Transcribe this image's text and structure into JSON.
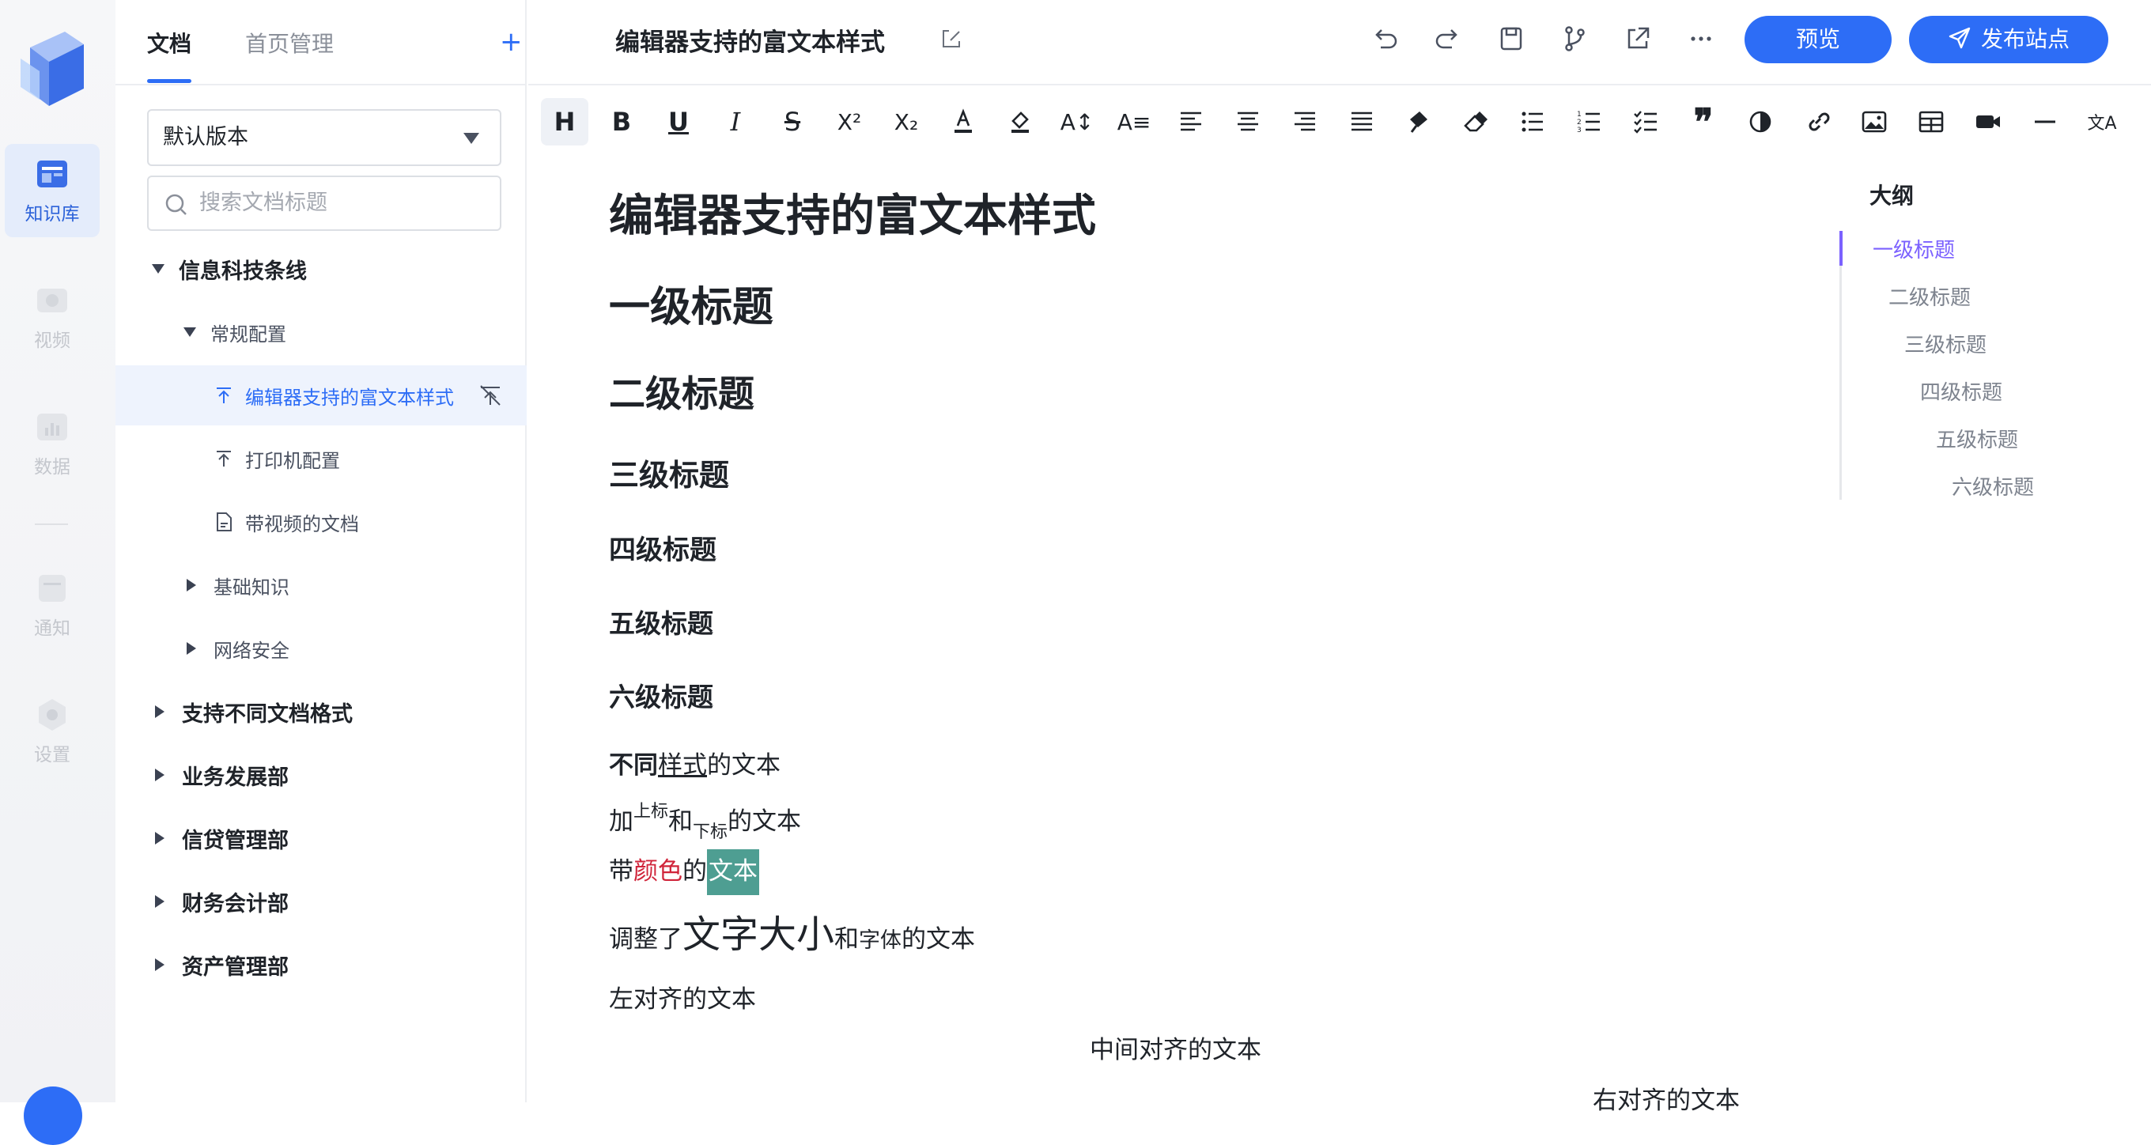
{
  "rail": {
    "items": [
      {
        "label": "知识库",
        "icon": "book-icon",
        "active": true
      },
      {
        "label": "视频",
        "icon": "video-icon",
        "active": false
      },
      {
        "label": "数据",
        "icon": "chart-icon",
        "active": false
      },
      {
        "label": "通知",
        "icon": "bell-icon",
        "active": false
      },
      {
        "label": "设置",
        "icon": "gear-icon",
        "active": false
      }
    ]
  },
  "tree": {
    "tabs": [
      "文档",
      "首页管理"
    ],
    "add_label": "+",
    "version": "默认版本",
    "search_placeholder": "搜索文档标题",
    "rows": [
      {
        "label": "信息科技条线",
        "level": 0,
        "expanded": true
      },
      {
        "label": "常规配置",
        "level": 1,
        "expanded": true
      },
      {
        "label": "编辑器支持的富文本样式",
        "level": 2,
        "icon": "pin-top-icon",
        "selected": true
      },
      {
        "label": "打印机配置",
        "level": 2,
        "icon": "pin-top-icon"
      },
      {
        "label": "带视频的文档",
        "level": 2,
        "icon": "document-icon"
      },
      {
        "label": "基础知识",
        "level": 1,
        "expanded": false
      },
      {
        "label": "网络安全",
        "level": 1,
        "expanded": false
      },
      {
        "label": "支持不同文档格式",
        "level": 0,
        "expanded": false
      },
      {
        "label": "业务发展部",
        "level": 0,
        "expanded": false
      },
      {
        "label": "信贷管理部",
        "level": 0,
        "expanded": false
      },
      {
        "label": "财务会计部",
        "level": 0,
        "expanded": false
      },
      {
        "label": "资产管理部",
        "level": 0,
        "expanded": false
      }
    ]
  },
  "header": {
    "title": "编辑器支持的富文本样式",
    "preview_label": "预览",
    "publish_label": "发布站点",
    "accent": "#2d6df6"
  },
  "toolbar": {
    "items": [
      "heading-icon",
      "bold-icon",
      "underline-icon",
      "italic-icon",
      "strikethrough-icon",
      "superscript-icon",
      "subscript-icon",
      "font-color-icon",
      "highlight-icon",
      "font-size-icon",
      "font-family-icon",
      "align-left-icon",
      "align-center-icon",
      "align-right-icon",
      "align-justify-icon",
      "format-painter-icon",
      "eraser-icon",
      "bullet-list-icon",
      "ordered-list-icon",
      "task-list-icon",
      "quote-icon",
      "contrast-icon",
      "link-icon",
      "image-icon",
      "table-icon",
      "video-icon",
      "divider-icon",
      "translate-icon"
    ]
  },
  "content": {
    "doc_title": "编辑器支持的富文本样式",
    "headings": [
      "一级标题",
      "二级标题",
      "三级标题",
      "四级标题",
      "五级标题",
      "六级标题"
    ],
    "line_style": {
      "a": "不同",
      "b": "样式",
      "c": "的",
      "d": "文本"
    },
    "line_supsub": {
      "a": "加",
      "sup": "上标",
      "b": "和",
      "sub": "下标",
      "c": "的文本"
    },
    "line_color": {
      "a": "带",
      "red": "颜色",
      "b": "的",
      "hl": "文本",
      "red_color": "#d0243a",
      "hl_color": "#4e9e92"
    },
    "line_size": {
      "a": "调整了",
      "big": "文字大小",
      "b": "和",
      "font": "字体",
      "c": "的文本"
    },
    "align_left": "左对齐的文本",
    "align_center": "中间对齐的文本",
    "align_right": "右对齐的文本"
  },
  "outline": {
    "title": "大纲",
    "items": [
      "一级标题",
      "二级标题",
      "三级标题",
      "四级标题",
      "五级标题",
      "六级标题"
    ],
    "active_color": "#7b61ff"
  }
}
